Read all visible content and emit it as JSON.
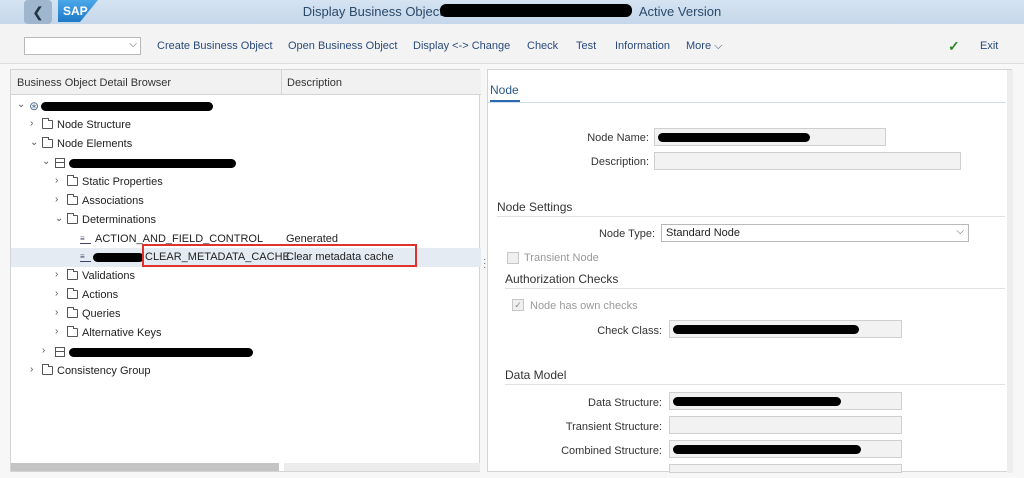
{
  "title_bar": {
    "back_glyph": "❮",
    "logo": "SAP",
    "title_start": "Display Business Object",
    "title_end": "Active Version"
  },
  "toolbar": {
    "command_field": "",
    "chevron": "⌵",
    "items": [
      "Create Business Object",
      "Open Business Object",
      "Display <-> Change",
      "Check",
      "Test",
      "Information",
      "More ⌵"
    ],
    "confirm_icon": "✓",
    "exit": "Exit"
  },
  "tree": {
    "header_col1": "Business Object Detail Browser",
    "header_col2": "Description",
    "rows": [
      {
        "label": "Node Structure",
        "desc": ""
      },
      {
        "label": "Node Elements",
        "desc": ""
      },
      {
        "label": "Static Properties",
        "desc": ""
      },
      {
        "label": "Associations",
        "desc": ""
      },
      {
        "label": "Determinations",
        "desc": ""
      },
      {
        "label": "ACTION_AND_FIELD_CONTROL",
        "desc": "Generated"
      },
      {
        "label": "CLEAR_METADATA_CACHE",
        "desc": "Clear metadata cache"
      },
      {
        "label": "Validations",
        "desc": ""
      },
      {
        "label": "Actions",
        "desc": ""
      },
      {
        "label": "Queries",
        "desc": ""
      },
      {
        "label": "Alternative Keys",
        "desc": ""
      },
      {
        "label": "Consistency Group",
        "desc": ""
      }
    ],
    "chevron_right": "›",
    "chevron_down": "⌄"
  },
  "detail": {
    "tab": "Node",
    "node_name_label": "Node Name:",
    "description_label": "Description:",
    "description_value": "",
    "node_settings_title": "Node Settings",
    "node_type_label": "Node Type:",
    "node_type_value": "Standard Node",
    "node_type_chevron": "⌵",
    "transient_node_label": "Transient Node",
    "authorization_title": "Authorization Checks",
    "own_checks_label": "Node has own checks",
    "own_checks_mark": "✓",
    "check_class_label": "Check Class:",
    "data_model_title": "Data Model",
    "data_structure_label": "Data Structure:",
    "transient_structure_label": "Transient Structure:",
    "transient_structure_value": "",
    "combined_structure_label": "Combined Structure:"
  },
  "colors": {
    "title_bar": "#c5d7ea",
    "toolbar_text": "#2a4a7a",
    "selection": "#e4ebf3",
    "highlight": "#e0312c",
    "confirm_green": "#2b8a2b"
  }
}
